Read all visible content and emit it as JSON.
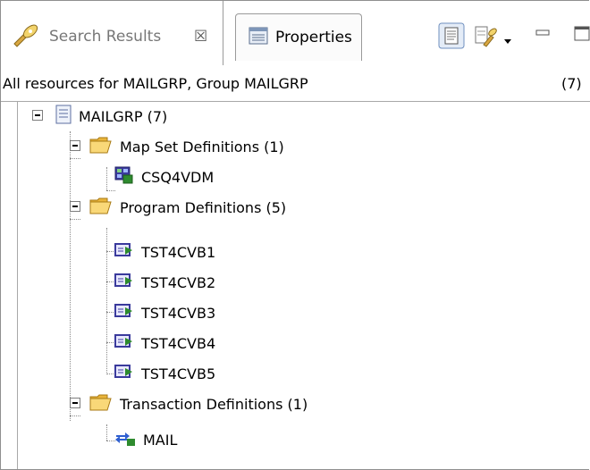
{
  "tabs": [
    {
      "label": "Search Results",
      "icon": "search-results-icon",
      "active": true
    },
    {
      "label": "Properties",
      "icon": "properties-icon",
      "active": false
    }
  ],
  "toolbar": {
    "buttons": [
      "show-details-icon",
      "filter-icon",
      "dropdown-arrow-icon",
      "minimize-icon",
      "maximize-icon"
    ]
  },
  "header": {
    "text": "All resources for MAILGRP, Group MAILGRP",
    "count": "(7)"
  },
  "tree": {
    "root": {
      "label": "MAILGRP (7)",
      "icon": "group-icon"
    },
    "groups": [
      {
        "label": "Map Set Definitions (1)",
        "icon": "folder-icon",
        "children": [
          {
            "label": "CSQ4VDM",
            "icon": "mapset-icon"
          }
        ]
      },
      {
        "label": "Program Definitions (5)",
        "icon": "folder-icon",
        "children": [
          {
            "label": "TST4CVB1",
            "icon": "program-icon"
          },
          {
            "label": "TST4CVB2",
            "icon": "program-icon"
          },
          {
            "label": "TST4CVB3",
            "icon": "program-icon"
          },
          {
            "label": "TST4CVB4",
            "icon": "program-icon"
          },
          {
            "label": "TST4CVB5",
            "icon": "program-icon"
          }
        ]
      },
      {
        "label": "Transaction Definitions (1)",
        "icon": "folder-icon",
        "children": [
          {
            "label": "MAIL",
            "icon": "transaction-icon"
          }
        ]
      }
    ]
  },
  "colors": {
    "folder": "#f5c542",
    "program": "#3a3a9c",
    "accent_green": "#2e8b2e"
  }
}
